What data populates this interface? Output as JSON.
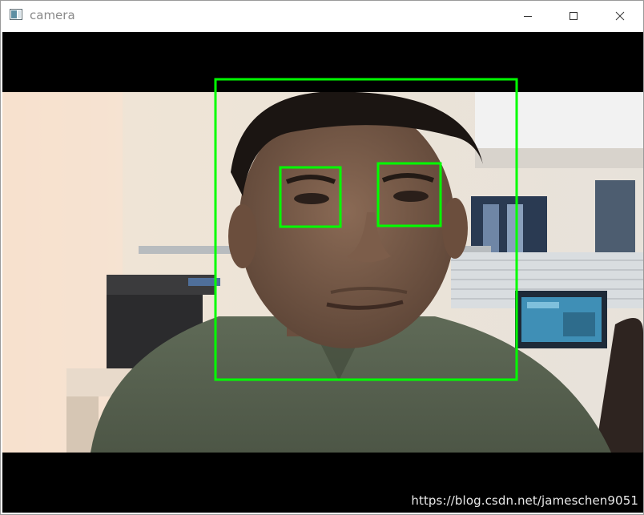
{
  "window": {
    "title": "camera",
    "controls": {
      "minimize": "minimize-icon",
      "maximize": "maximize-icon",
      "close": "close-icon"
    }
  },
  "detections": {
    "color": "#00ff00",
    "face_count": 1,
    "eye_count": 2
  },
  "watermark": "https://blog.csdn.net/jameschen9051"
}
